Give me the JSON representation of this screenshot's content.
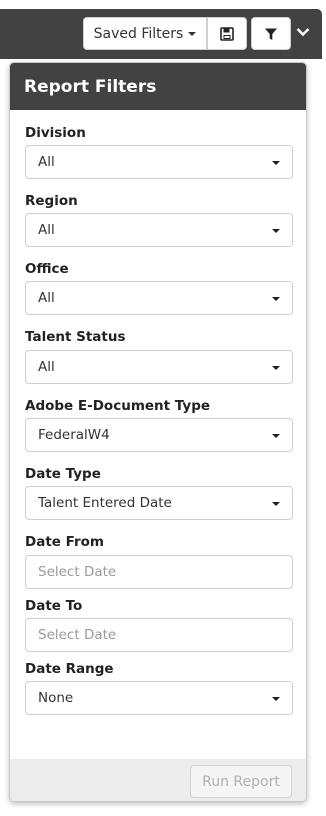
{
  "toolbar": {
    "saved_filters_label": "Saved Filters",
    "save_icon": "floppy-disk-icon",
    "filter_icon": "funnel-icon",
    "collapse_icon": "chevron-down-icon"
  },
  "panel": {
    "title": "Report Filters",
    "fields": [
      {
        "label": "Division",
        "type": "select",
        "value": "All"
      },
      {
        "label": "Region",
        "type": "select",
        "value": "All"
      },
      {
        "label": "Office",
        "type": "select",
        "value": "All"
      },
      {
        "label": "Talent Status",
        "type": "select",
        "value": "All"
      },
      {
        "label": "Adobe E-Document Type",
        "type": "select",
        "value": "FederalW4"
      },
      {
        "label": "Date Type",
        "type": "select",
        "value": "Talent Entered Date"
      },
      {
        "label": "Date From",
        "type": "date",
        "placeholder": "Select Date"
      },
      {
        "label": "Date To",
        "type": "date",
        "placeholder": "Select Date"
      },
      {
        "label": "Date Range",
        "type": "select",
        "value": "None"
      }
    ],
    "run_label": "Run Report"
  },
  "colors": {
    "header_bg": "#424242",
    "footer_bg": "#ececec",
    "border": "#cfcfcf"
  }
}
